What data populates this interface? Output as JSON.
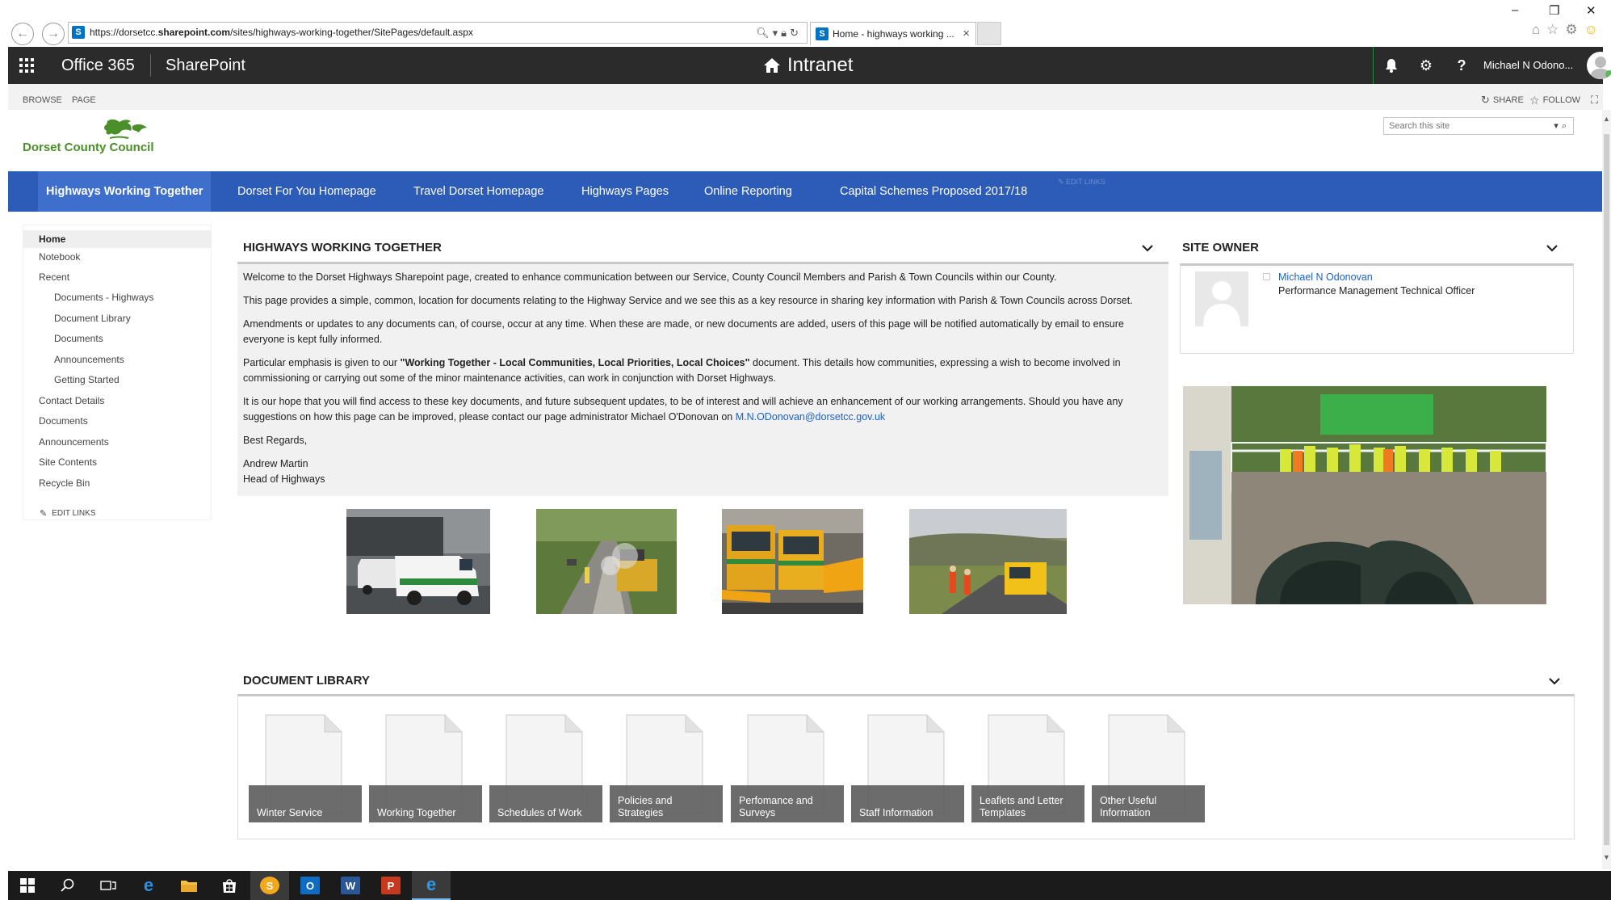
{
  "browser": {
    "url_prefix": "https://dorsetcc.",
    "url_domain": "sharepoint.com",
    "url_path": "/sites/highways-working-together/SitePages/default.aspx",
    "tab_title": "Home - highways working ...",
    "tab_close": "×",
    "win_minimize": "–",
    "win_restore": "❐",
    "win_close": "✕"
  },
  "suite": {
    "office_label": "Office 365",
    "sharepoint_label": "SharePoint",
    "intranet_title": "Intranet",
    "user_name": "Michael N Odono..."
  },
  "ribbon": {
    "browse": "BROWSE",
    "page": "PAGE",
    "share": "SHARE",
    "follow": "FOLLOW"
  },
  "header": {
    "logo_text": "Dorset County Council",
    "search_placeholder": "Search this site"
  },
  "top_nav": {
    "items": [
      {
        "label": "Highways Working Together"
      },
      {
        "label": "Dorset For You Homepage"
      },
      {
        "label": "Travel Dorset Homepage"
      },
      {
        "label": "Highways Pages"
      },
      {
        "label": "Online Reporting"
      },
      {
        "label": "Capital Schemes Proposed 2017/18"
      }
    ],
    "edit_links": "EDIT LINKS"
  },
  "quick_launch": {
    "items": [
      {
        "label": "Home"
      },
      {
        "label": "Notebook"
      },
      {
        "label": "Recent"
      },
      {
        "label": "Documents - Highways"
      },
      {
        "label": "Document Library"
      },
      {
        "label": "Documents"
      },
      {
        "label": "Announcements"
      },
      {
        "label": "Getting Started"
      },
      {
        "label": "Contact Details"
      },
      {
        "label": "Documents"
      },
      {
        "label": "Announcements"
      },
      {
        "label": "Site Contents"
      },
      {
        "label": "Recycle Bin"
      }
    ],
    "edit_links": "EDIT LINKS"
  },
  "main": {
    "title": "HIGHWAYS WORKING TOGETHER",
    "p1": "Welcome to the Dorset Highways Sharepoint page, created to enhance communication between our Service, County Council Members and Parish & Town Councils within our County.",
    "p2": "This page provides a simple, common, location for documents relating to the Highway Service and we see this as a key resource in sharing key information with Parish & Town Councils across Dorset.",
    "p3": "Amendments or updates to any documents can, of course, occur at any time. When these are made, or new documents are added, users of this page will be notified automatically by email to ensure everyone is kept fully informed.",
    "p4_pre": "Particular emphasis is given to our ",
    "p4_bold": "\"Working Together - Local Communities, Local Priorities, Local Choices\"",
    "p4_post": " document. This details how communities, expressing a wish to become involved in commissioning or carrying out some of the minor maintenance activities, can work in conjunction with Dorset Highways.",
    "p5_text": "It is our hope that you will find access to these key documents, and future subsequent updates, to be of interest and will achieve an enhancement of our working arrangements. Should you have any suggestions on how this page can be improved, please contact our page administrator Michael O'Donovan on ",
    "p5_email": "M.N.ODonovan@dorsetcc.gov.uk",
    "regards": "Best Regards,",
    "signer_name": "Andrew Martin",
    "signer_title": "Head of Highways"
  },
  "site_owner": {
    "title": "SITE OWNER",
    "name": "Michael N Odonovan",
    "role": "Performance Management Technical Officer"
  },
  "doc_library": {
    "title": "DOCUMENT LIBRARY",
    "tiles": [
      {
        "label": "Winter Service"
      },
      {
        "label": "Working Together"
      },
      {
        "label": "Schedules of Work"
      },
      {
        "label": "Policies and Strategies"
      },
      {
        "label": "Perfomance and Surveys"
      },
      {
        "label": "Staff Information"
      },
      {
        "label": "Leaflets and Letter Templates"
      },
      {
        "label": "Other Useful Information"
      }
    ]
  },
  "colors": {
    "suite_bar": "#2b2b2b",
    "top_nav": "#2d5cb8",
    "logo_green": "#4a8f29",
    "link_blue": "#1a62c7"
  }
}
